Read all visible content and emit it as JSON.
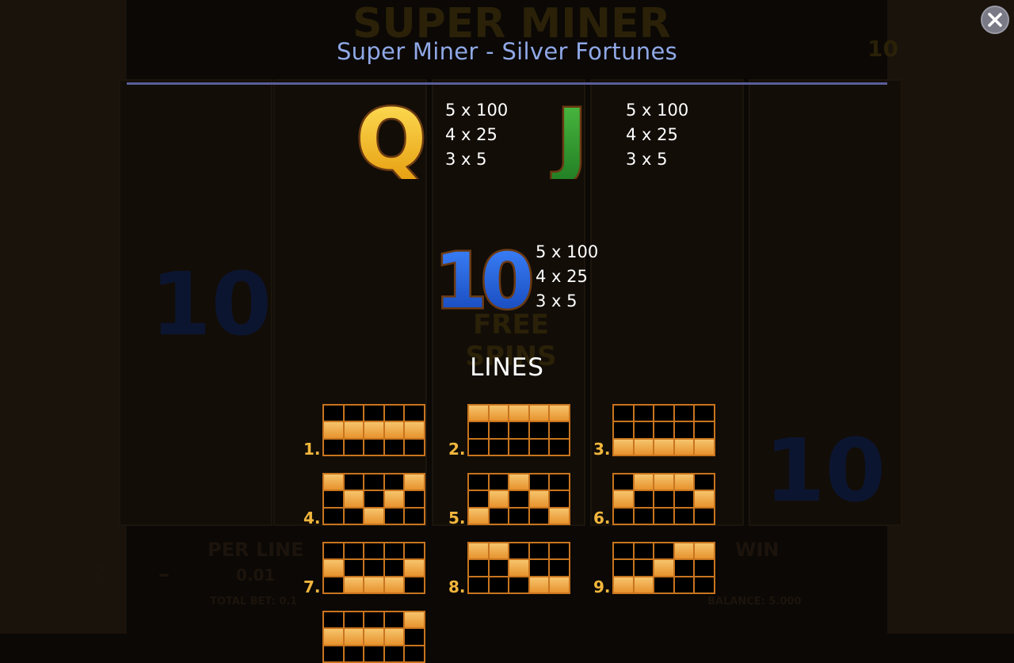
{
  "title": "Super Miner - Silver Fortunes",
  "close_icon": "close-icon",
  "symbols": [
    {
      "glyph": "Q",
      "color": "#f0b417",
      "pays": [
        "5 x 100",
        "4 x 25",
        "3 x 5"
      ]
    },
    {
      "glyph": "J",
      "color": "#2b9a2e",
      "pays": [
        "5 x 100",
        "4 x 25",
        "3 x 5"
      ]
    },
    {
      "glyph": "10",
      "color": "#1c56c8",
      "pays": [
        "5 x 100",
        "4 x 25",
        "3 x 5"
      ]
    }
  ],
  "lines_title": "LINES",
  "lines": [
    {
      "number": "1.",
      "cells": [
        [
          1,
          0
        ],
        [
          1,
          1
        ],
        [
          1,
          2
        ],
        [
          1,
          3
        ],
        [
          1,
          4
        ]
      ]
    },
    {
      "number": "2.",
      "cells": [
        [
          0,
          0
        ],
        [
          0,
          1
        ],
        [
          0,
          2
        ],
        [
          0,
          3
        ],
        [
          0,
          4
        ]
      ]
    },
    {
      "number": "3.",
      "cells": [
        [
          2,
          0
        ],
        [
          2,
          1
        ],
        [
          2,
          2
        ],
        [
          2,
          3
        ],
        [
          2,
          4
        ]
      ]
    },
    {
      "number": "4.",
      "cells": [
        [
          0,
          0
        ],
        [
          1,
          1
        ],
        [
          2,
          2
        ],
        [
          1,
          3
        ],
        [
          0,
          4
        ]
      ]
    },
    {
      "number": "5.",
      "cells": [
        [
          2,
          0
        ],
        [
          1,
          1
        ],
        [
          0,
          2
        ],
        [
          1,
          3
        ],
        [
          2,
          4
        ]
      ]
    },
    {
      "number": "6.",
      "cells": [
        [
          1,
          0
        ],
        [
          0,
          1
        ],
        [
          0,
          2
        ],
        [
          0,
          3
        ],
        [
          1,
          4
        ]
      ]
    },
    {
      "number": "7.",
      "cells": [
        [
          1,
          0
        ],
        [
          2,
          1
        ],
        [
          2,
          2
        ],
        [
          2,
          3
        ],
        [
          1,
          4
        ]
      ]
    },
    {
      "number": "8.",
      "cells": [
        [
          0,
          0
        ],
        [
          0,
          1
        ],
        [
          1,
          2
        ],
        [
          2,
          3
        ],
        [
          2,
          4
        ]
      ]
    },
    {
      "number": "9.",
      "cells": [
        [
          2,
          0
        ],
        [
          2,
          1
        ],
        [
          1,
          2
        ],
        [
          0,
          3
        ],
        [
          0,
          4
        ]
      ]
    },
    {
      "number": "",
      "cells": [
        [
          0,
          4
        ],
        [
          1,
          0
        ],
        [
          1,
          1
        ],
        [
          1,
          2
        ],
        [
          1,
          3
        ]
      ]
    }
  ],
  "background": {
    "game_logo": "SUPER MINER",
    "per_line_label": "PER LINE",
    "per_line_value": "0.01",
    "total_bet": "TOTAL BET: 0.1",
    "balance": "BALANCE: 5.000",
    "win_label": "WIN",
    "help_glyph": "?",
    "minus_glyph": "–",
    "free_spins_text": "FREE SPINS",
    "corner_value": "10"
  }
}
